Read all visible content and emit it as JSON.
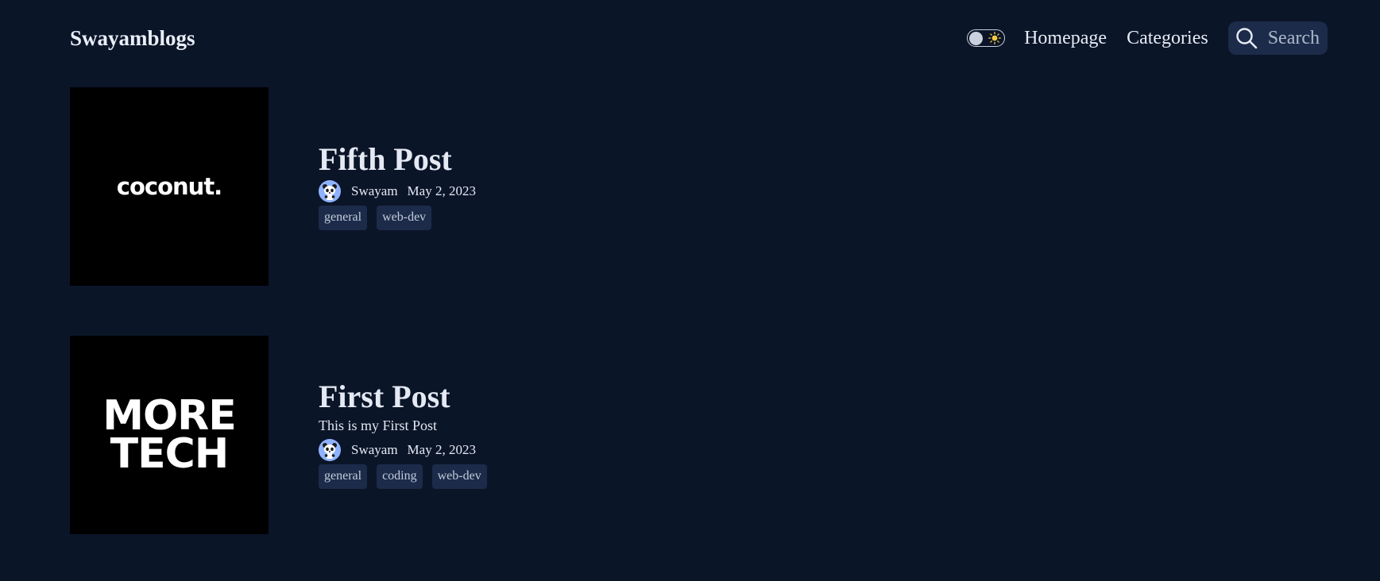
{
  "header": {
    "brand": "Swayamblogs",
    "nav": {
      "homepage": "Homepage",
      "categories": "Categories"
    },
    "search_label": "Search",
    "theme_toggle": {
      "icon": "sun-icon",
      "state": "off"
    }
  },
  "posts": [
    {
      "title": "Fifth Post",
      "description": "",
      "author": "Swayam",
      "date": "May 2, 2023",
      "thumbnail_text": "coconut.",
      "tags": [
        "general",
        "web-dev"
      ]
    },
    {
      "title": "First Post",
      "description": "This is my First Post",
      "author": "Swayam",
      "date": "May 2, 2023",
      "thumbnail_text": [
        "MORE",
        "TECH"
      ],
      "tags": [
        "general",
        "coding",
        "web-dev"
      ]
    }
  ],
  "colors": {
    "background": "#0b1528",
    "tag_bg": "#1c2b4a",
    "text": "#e6ebf5"
  }
}
